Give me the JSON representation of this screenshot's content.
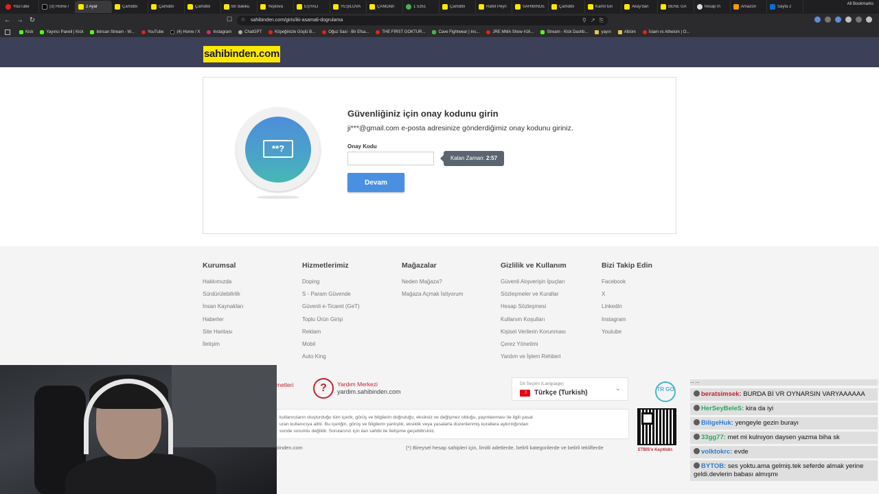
{
  "browser": {
    "tabs": [
      {
        "title": "YouTube",
        "icon": "yt"
      },
      {
        "title": "(3) Home /",
        "icon": "x"
      },
      {
        "title": "2 Ayar",
        "icon": "s"
      },
      {
        "title": "Çamdibi",
        "icon": "s"
      },
      {
        "title": "Çamdibi",
        "icon": "s"
      },
      {
        "title": "Çamdibi",
        "icon": "s"
      },
      {
        "title": "Bir dakiku",
        "icon": "s"
      },
      {
        "title": "Yeşilova",
        "icon": "s"
      },
      {
        "title": "EŞYALI",
        "icon": "s"
      },
      {
        "title": "YEŞİLOVA",
        "icon": "s"
      },
      {
        "title": "ÇAMDİBİ",
        "icon": "s"
      },
      {
        "title": "1 5351",
        "icon": "g"
      },
      {
        "title": "Çamdibi",
        "icon": "s"
      },
      {
        "title": "Rafet Peyn",
        "icon": "s"
      },
      {
        "title": "SAHİBİNDE",
        "icon": "s"
      },
      {
        "title": "Çamdibi",
        "icon": "s"
      },
      {
        "title": "Kamil tun",
        "icon": "s"
      },
      {
        "title": "Akay'dan",
        "icon": "s"
      },
      {
        "title": "BENE GA",
        "icon": "s"
      },
      {
        "title": "hesap m",
        "icon": "gl"
      },
      {
        "title": "Amazon",
        "icon": "am"
      },
      {
        "title": "Sayfa 2",
        "icon": "ms"
      }
    ],
    "active_tab_index": 2,
    "url": "sahibinden.com/giris/iki-asamali-dogrulama",
    "bookmarks": [
      {
        "label": "Kick",
        "icon": "kick"
      },
      {
        "label": "Yayıncı Paneli | Kick",
        "icon": "kick"
      },
      {
        "label": "ikinsan Stream - W...",
        "icon": "kick"
      },
      {
        "label": "YouTube",
        "icon": "yt"
      },
      {
        "label": "(4) Home / X",
        "icon": "x"
      },
      {
        "label": "Instagram",
        "icon": "ig"
      },
      {
        "label": "ChatGPT",
        "icon": "gpt"
      },
      {
        "label": "Köpeğinizle Güçlü B...",
        "icon": "yt"
      },
      {
        "label": "Oğuz Sasi - Bir Efsa...",
        "icon": "yt"
      },
      {
        "label": "THE FIRST GOKTUR...",
        "icon": "yt"
      },
      {
        "label": "Cave Fightwear | Ins...",
        "icon": "cf"
      },
      {
        "label": "JRE MMA Show #16...",
        "icon": "yt"
      },
      {
        "label": "Stream - Kick Dashb...",
        "icon": "kick"
      },
      {
        "label": "yayın",
        "icon": "folder"
      },
      {
        "label": "Albüm",
        "icon": "folder"
      },
      {
        "label": "İslam vs Atheism | O...",
        "icon": "yt"
      }
    ],
    "all_bookmarks": "All Bookmarks"
  },
  "site": {
    "logo": "sahibinden.com",
    "brand_color": "#ffe800",
    "header_color": "#3c4058"
  },
  "verify": {
    "title": "Güvenliğiniz için onay kodunu girin",
    "description": "ji***@gmail.com e-posta adresinize gönderdiğimiz onay kodunu giriniz.",
    "code_label": "Onay Kodu",
    "code_value": "",
    "timer_label": "Kalan Zaman:",
    "timer_value": "2:57",
    "submit": "Devam",
    "badge_text": "**?"
  },
  "footer": {
    "columns": [
      {
        "title": "Kurumsal",
        "links": [
          "Hakkımızda",
          "Sürdürülebilirlik",
          "İnsan Kaynakları",
          "Haberler",
          "Site Haritası",
          "İletişim"
        ]
      },
      {
        "title": "Hizmetlerimiz",
        "links": [
          "Doping",
          "S - Param Güvende",
          "Güvenli e-Ticaret (GeT)",
          "Toplu Ürün Girişi",
          "Reklam",
          "Mobil",
          "Auto King"
        ]
      },
      {
        "title": "Mağazalar",
        "links": [
          "Neden Mağaza?",
          "Mağaza Açmak İstiyorum"
        ]
      },
      {
        "title": "Gizlilik ve Kullanım",
        "links": [
          "Güvenli Alışverişin İpuçları",
          "Sözleşmeler ve Kurallar",
          "Hesap Sözleşmesi",
          "Kullanım Koşulları",
          "Kişisel Verilerin Korunması",
          "Çerez Yönetimi",
          "Yardım ve İşlem Rehberi"
        ]
      },
      {
        "title": "Bizi Takip Edin",
        "links": [
          "Facebook",
          "X",
          "Linkedin",
          "Instagram",
          "Youtube"
        ]
      }
    ],
    "partial_left_label": "metleri",
    "help_title": "Yardım Merkezi",
    "help_url": "yardim.sahibinden.com",
    "lang_caption": "Dil Seçimi (Language)",
    "lang_value": "Türkçe (Turkish)",
    "trgo": "TR GO",
    "disclaimer_lines": [
      "kullanıcıların oluşturduğu tüm içerik, görüş ve bilgilerin doğruluğu, eksiksiz ve değişmez olduğu, yayınlanması ile ilgili yasal",
      "uran kullanıcıya aittir. Bu içeriğin, görüş ve bilgilerin yanlışlık, eksiklik veya yasalarla düzenlenmiş kurallara aykırılığından",
      "sonde sorumlu değildir. Sorularınız için ilan sahibi ile iletişime geçebilirsiniz."
    ],
    "bottom_left": "binden.com",
    "bottom_note": "(*) Bireysel hesap sahipleri için, limitli adetlerde, belirli kategorilerde ve belirli tekliflerde",
    "etbis": "ETBİS'e Kayıtlıdır."
  },
  "chat": {
    "messages": [
      {
        "user": "",
        "text": "... ...",
        "color": "#333333",
        "partial": true
      },
      {
        "user": "beratsimsek:",
        "text": "BURDA Bİ VR OYNARSIN VARYAAAAAA",
        "color": "#c0232f"
      },
      {
        "user": "HerSeyBeleS:",
        "text": "kira da iyi",
        "color": "#2ba85a"
      },
      {
        "user": "BiligeHuk:",
        "text": "yengeyle gezin burayı",
        "color": "#2b7bd6"
      },
      {
        "user": "33gg77:",
        "text": "met mi kulnıyon daysen yazma biha sk",
        "color": "#2ba85a"
      },
      {
        "user": "volktokrc:",
        "text": "evde",
        "color": "#2b7bd6"
      },
      {
        "user": "BYTOB:",
        "text": "ses yoktu.ama gelmiş.tek seferde almak yerine geldi.devlerin babası almışmı",
        "color": "#2b7bd6"
      }
    ]
  }
}
